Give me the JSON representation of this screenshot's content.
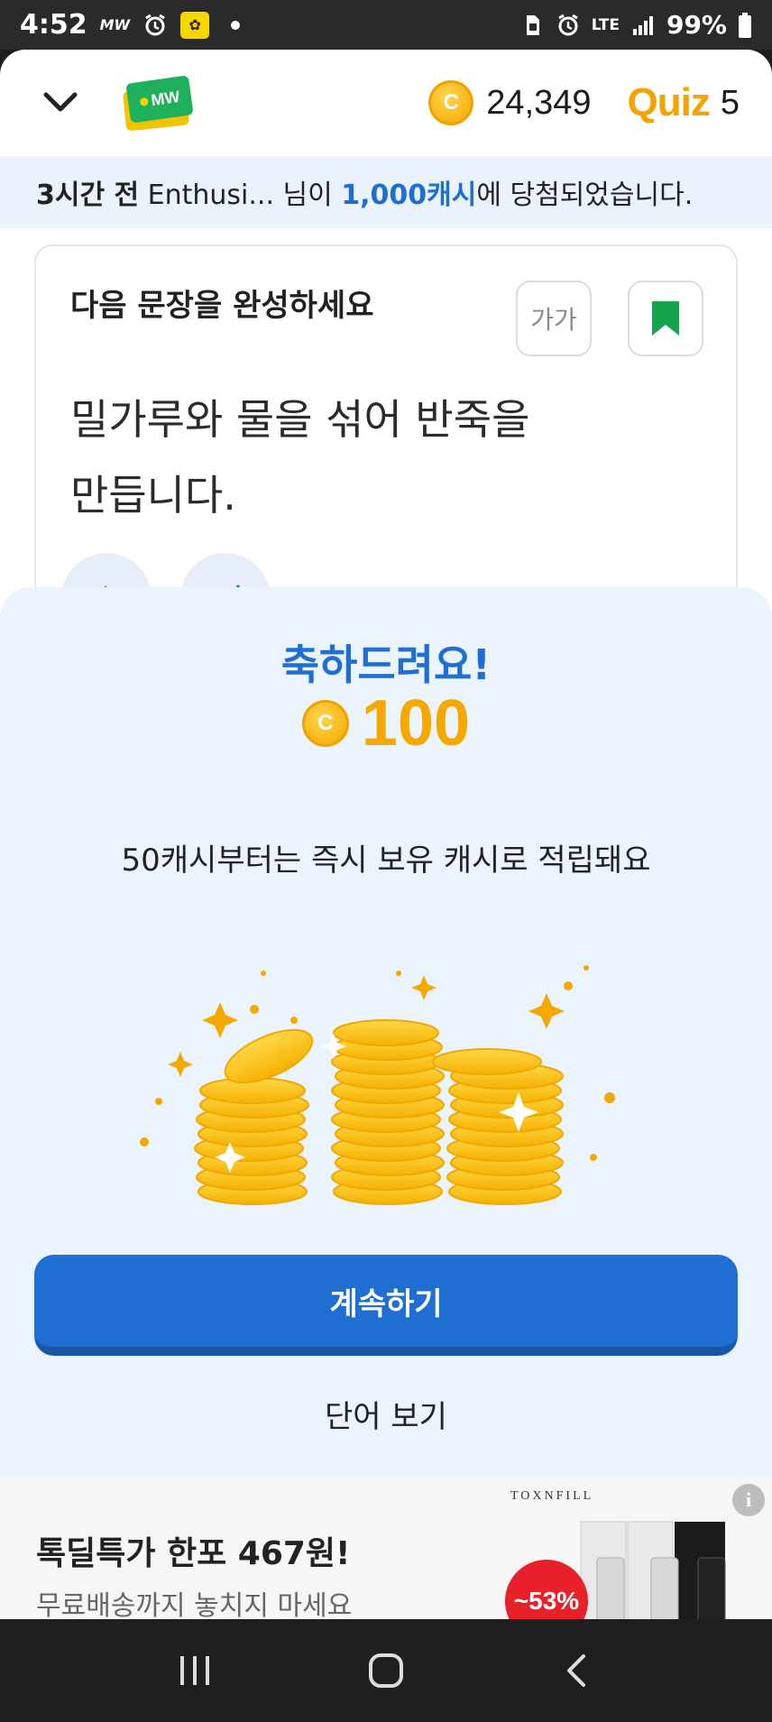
{
  "status_bar": {
    "time": "4:52",
    "mw_label": "MW",
    "network": "LTE",
    "battery": "99%"
  },
  "header": {
    "logo_text": "MW",
    "coin_symbol": "C",
    "coin_count": "24,349",
    "quiz_label": "Quiz",
    "quiz_count": "5"
  },
  "banner": {
    "time_ago": "3시간 전",
    "user": " Enthusi... 님이 ",
    "amount": "1,000캐시",
    "suffix": "에 당첨되었습니다."
  },
  "question": {
    "title": "다음 문장을 완성하세요",
    "font_size_label": "가가",
    "sentence_line1": "밀가루와 물을 섞어 반죽을",
    "sentence_line2": "만듭니다."
  },
  "reward_sheet": {
    "congrats": "축하드려요!",
    "coin_symbol": "C",
    "amount": "100",
    "subtext": "50캐시부터는 즉시 보유 캐시로 적립돼요",
    "continue_label": "계속하기",
    "view_word_label": "단어 보기"
  },
  "ad": {
    "title": "톡딜특가 한포 467원!",
    "subtitle": "무료배송까지 놓치지 마세요",
    "brand": "TOXNFILL",
    "discount": "~53%",
    "info_icon": "i"
  },
  "colors": {
    "primary": "#1f6fd3",
    "coin": "#f5a800",
    "sheet_bg": "#ebf3fd",
    "bookmark": "#14a44d"
  }
}
